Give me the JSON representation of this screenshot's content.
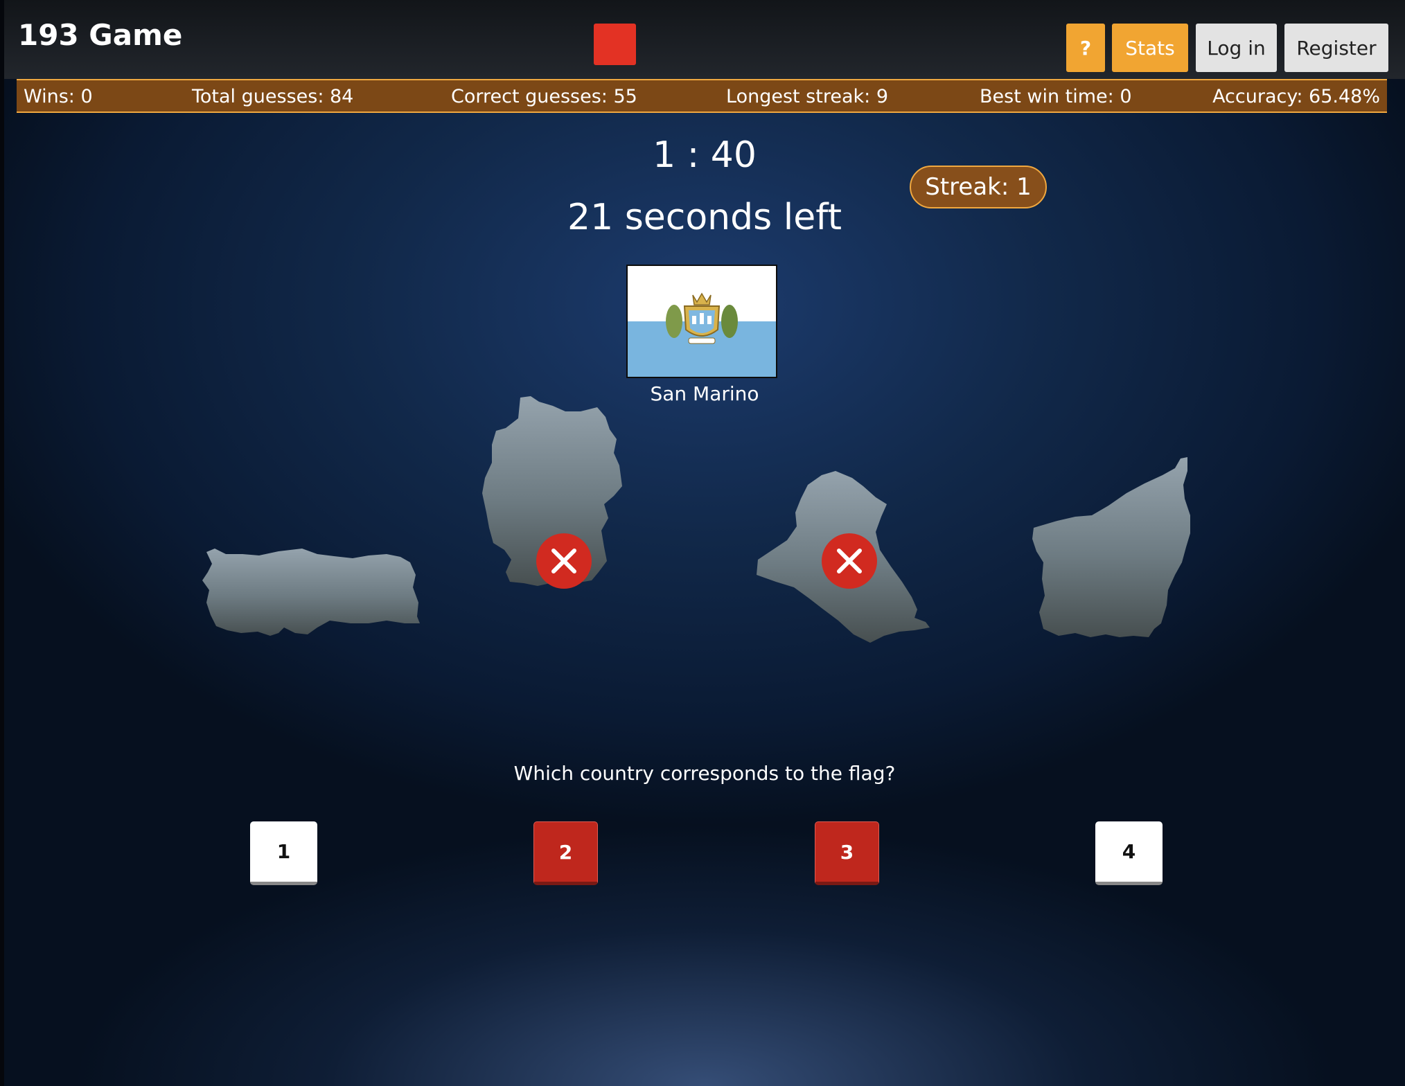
{
  "header": {
    "title": "193 Game",
    "help_label": "?",
    "stats_label": "Stats",
    "login_label": "Log in",
    "register_label": "Register"
  },
  "stats": {
    "wins": "Wins: 0",
    "total_guesses": "Total guesses: 84",
    "correct_guesses": "Correct guesses: 55",
    "longest_streak": "Longest streak: 9",
    "best_win_time": "Best win time: 0",
    "accuracy": "Accuracy: 65.48%"
  },
  "game": {
    "timer": "1 : 40",
    "seconds_left": "21 seconds left",
    "streak": "Streak: 1",
    "flag_country": "San Marino",
    "question": "Which country corresponds to the flag?",
    "choices": [
      {
        "label": "1",
        "status": "unanswered",
        "shape": "turkey-silhouette"
      },
      {
        "label": "2",
        "status": "wrong",
        "shape": "germany-silhouette"
      },
      {
        "label": "3",
        "status": "wrong",
        "shape": "iraq-silhouette"
      },
      {
        "label": "4",
        "status": "unanswered",
        "shape": "san-marino-silhouette"
      }
    ]
  },
  "colors": {
    "accent_orange": "#f1a532",
    "stats_bar": "#7c4816",
    "wrong_red": "#d12a20",
    "stop_red": "#e33224"
  }
}
